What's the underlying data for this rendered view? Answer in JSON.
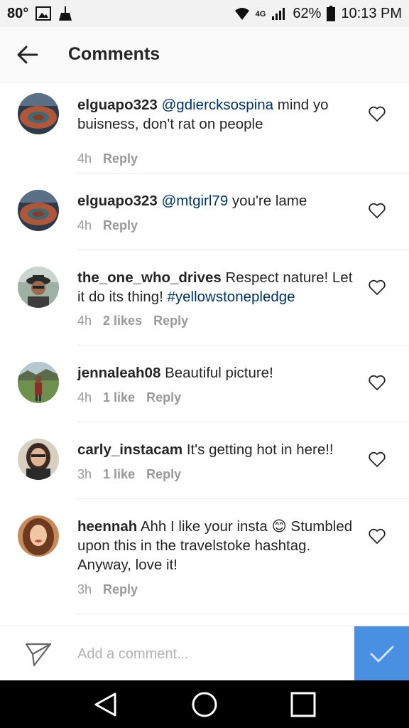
{
  "status_bar": {
    "temperature": "80°",
    "network": "4G",
    "battery_percent": "62%",
    "time": "10:13 PM",
    "icons": [
      "image-icon",
      "broom-icon",
      "wifi-icon",
      "signal-icon",
      "battery-icon"
    ]
  },
  "header": {
    "title": "Comments",
    "back_icon": "back-arrow-icon"
  },
  "comments": [
    {
      "username": "elguapo323",
      "mention": "@gdiercksospina",
      "text": " mind yo buisness, don't rat on people",
      "hashtag": "",
      "time": "4h",
      "likes": "",
      "reply_label": "Reply"
    },
    {
      "username": "elguapo323",
      "mention": "@mtgirl79",
      "text": " you're lame",
      "hashtag": "",
      "time": "4h",
      "likes": "",
      "reply_label": "Reply"
    },
    {
      "username": "the_one_who_drives",
      "mention": "",
      "text": " Respect nature! Let it do its thing! ",
      "hashtag": "#yellowstonepledge",
      "time": "4h",
      "likes": "2 likes",
      "reply_label": "Reply"
    },
    {
      "username": "jennaleah08",
      "mention": "",
      "text": " Beautiful picture!",
      "hashtag": "",
      "time": "4h",
      "likes": "1 like",
      "reply_label": "Reply"
    },
    {
      "username": "carly_instacam",
      "mention": "",
      "text": " It's getting hot in here!!",
      "hashtag": "",
      "time": "3h",
      "likes": "1 like",
      "reply_label": "Reply"
    },
    {
      "username": "heennah",
      "mention": "",
      "text": " Ahh I like your insta 😊 Stumbled upon this in the travelstoke hashtag. Anyway, love it!",
      "hashtag": "",
      "time": "3h",
      "likes": "",
      "reply_label": "Reply"
    }
  ],
  "input_bar": {
    "placeholder": "Add a comment...",
    "post_button_icon": "checkmark-icon",
    "send_icon": "paper-plane-icon"
  },
  "nav_bar": {
    "buttons": [
      "back-triangle-icon",
      "home-circle-icon",
      "recents-square-icon"
    ]
  },
  "colors": {
    "mention": "#003569",
    "post_button": "#4a90e2",
    "meta_text": "#999999"
  }
}
